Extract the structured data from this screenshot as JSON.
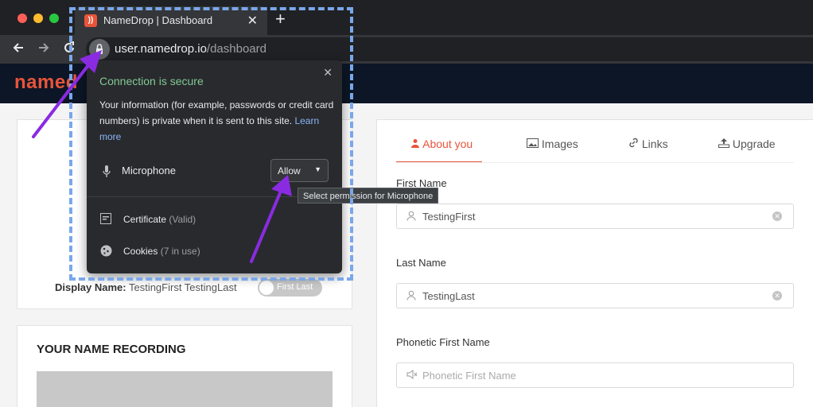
{
  "browser": {
    "tab_title": "NameDrop | Dashboard",
    "tab_close": "✕",
    "new_tab": "+",
    "url_host": "user.namedrop.io",
    "url_path": "/dashboard",
    "favicon_glyph": "))"
  },
  "site": {
    "logo_text": "named"
  },
  "left_panel": {
    "display_name_label": "Display Name:",
    "display_name_value": " TestingFirst TestingLast",
    "toggle_label": "First Last",
    "recording_title": "YOUR NAME RECORDING"
  },
  "profile_form": {
    "tabs": [
      {
        "label": "About you",
        "icon": "user-icon"
      },
      {
        "label": "Images",
        "icon": "image-icon"
      },
      {
        "label": "Links",
        "icon": "link-icon"
      },
      {
        "label": "Upgrade",
        "icon": "upgrade-icon"
      }
    ],
    "fields": [
      {
        "label": "First Name",
        "value": "TestingFirst",
        "placeholder": ""
      },
      {
        "label": "Last Name",
        "value": "TestingLast",
        "placeholder": ""
      },
      {
        "label": "Phonetic First Name",
        "value": "",
        "placeholder": "Phonetic First Name"
      }
    ]
  },
  "site_info_popup": {
    "title": "Connection is secure",
    "description": "Your information (for example, passwords or credit card numbers) is private when it is sent to this site.",
    "learn_more": "Learn more",
    "permission_label": "Microphone",
    "permission_value": "Allow",
    "certificate_label": "Certificate",
    "certificate_status": "(Valid)",
    "cookies_label": "Cookies",
    "cookies_status": "(7 in use)",
    "close": "✕"
  },
  "tooltip": "Select permission for Microphone",
  "colors": {
    "accent": "#e8543a",
    "secure_green": "#81c995",
    "link_blue": "#8ab4f8",
    "annotation_purple": "#8a2be2",
    "dashed_box": "#7aa7ea"
  }
}
